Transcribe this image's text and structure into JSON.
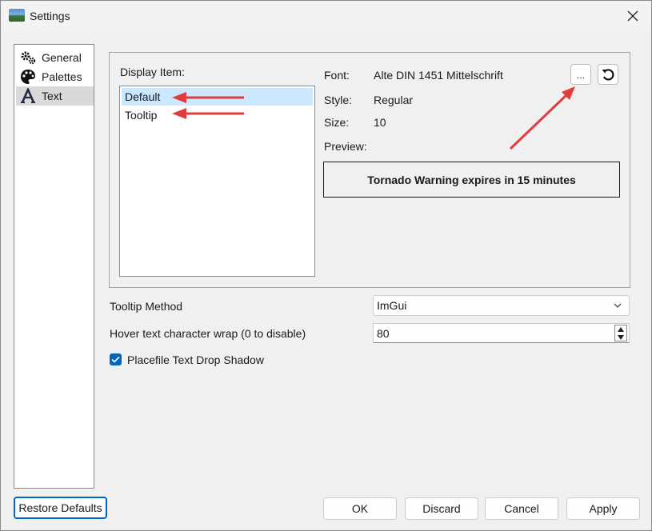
{
  "window": {
    "title": "Settings",
    "close_icon": "close-icon"
  },
  "sidebar": {
    "items": [
      {
        "label": "General",
        "icon": "gears-icon"
      },
      {
        "label": "Palettes",
        "icon": "palette-icon"
      },
      {
        "label": "Text",
        "icon": "text-a-icon",
        "selected": true
      }
    ]
  },
  "display_item": {
    "label": "Display Item:",
    "items": [
      {
        "label": "Default",
        "selected": true
      },
      {
        "label": "Tooltip",
        "selected": false
      }
    ]
  },
  "font": {
    "font_label": "Font:",
    "font_value": "Alte DIN 1451 Mittelschrift",
    "style_label": "Style:",
    "style_value": "Regular",
    "size_label": "Size:",
    "size_value": "10",
    "preview_label": "Preview:",
    "preview_text": "Tornado Warning expires in 15 minutes",
    "browse_label": "...",
    "reset_icon": "reset-icon"
  },
  "tooltip_method": {
    "label": "Tooltip Method",
    "value": "ImGui"
  },
  "hover_wrap": {
    "label": "Hover text character wrap (0 to disable)",
    "value": "80"
  },
  "drop_shadow": {
    "label": "Placefile Text Drop Shadow",
    "checked": true
  },
  "buttons": {
    "restore_defaults": "Restore Defaults",
    "ok": "OK",
    "discard": "Discard",
    "cancel": "Cancel",
    "apply": "Apply"
  },
  "colors": {
    "accent": "#0067c0",
    "selection": "#cce8ff",
    "annotation_arrow": "#e03c3c"
  }
}
